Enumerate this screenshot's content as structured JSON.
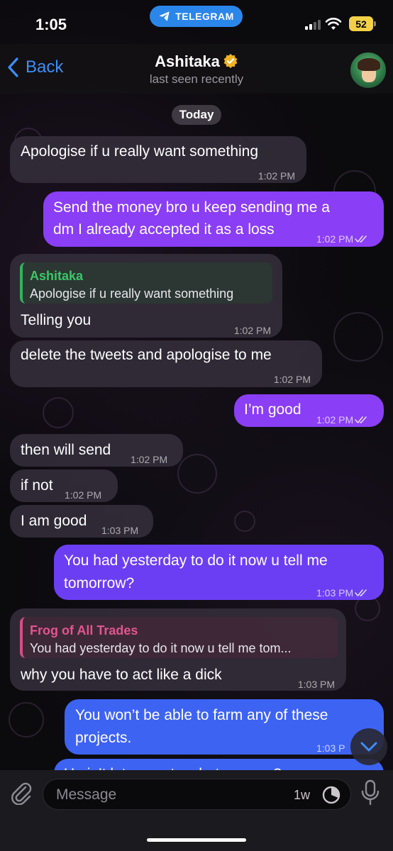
{
  "status_bar": {
    "time": "1:05",
    "app_pill": "TELEGRAM",
    "battery": "52"
  },
  "header": {
    "back_label": "Back",
    "contact_name": "Ashitaka",
    "last_seen": "last seen recently"
  },
  "chat": {
    "date_chip": "Today",
    "messages": [
      {
        "direction": "in",
        "lines": [
          "Apologise if u really want something"
        ],
        "time": "1:02 PM"
      },
      {
        "direction": "out",
        "lines": [
          "Send the money bro u keep sending me a",
          "dm I already accepted it as a loss"
        ],
        "time": "1:02 PM",
        "read": true
      },
      {
        "direction": "in",
        "reply_to": {
          "name": "Ashitaka",
          "text": "Apologise if u really want something"
        },
        "lines": [
          "Telling you"
        ],
        "time": "1:02 PM"
      },
      {
        "direction": "in",
        "lines": [
          "delete the tweets and apologise to me"
        ],
        "time": "1:02 PM"
      },
      {
        "direction": "out",
        "lines": [
          "I’m good"
        ],
        "time": "1:02 PM",
        "read": true
      },
      {
        "direction": "in",
        "lines": [
          "then will send"
        ],
        "time": "1:02 PM"
      },
      {
        "direction": "in",
        "lines": [
          "if not"
        ],
        "time": "1:02 PM"
      },
      {
        "direction": "in",
        "lines": [
          "I am good"
        ],
        "time": "1:03 PM"
      },
      {
        "direction": "out",
        "lines": [
          "You had yesterday to do it now u tell me",
          "tomorrow?"
        ],
        "time": "1:03 PM",
        "read": true
      },
      {
        "direction": "in",
        "reply_to": {
          "name": "Frog of All Trades",
          "text": "You had yesterday to do it now u tell me tom..."
        },
        "lines": [
          "why you have to act like a dick"
        ],
        "time": "1:03 PM"
      },
      {
        "direction": "out",
        "lines": [
          "You won’t be able to farm any of these",
          "projects."
        ],
        "time": "1:03 P"
      },
      {
        "direction": "out",
        "lines": [
          "U ain’t let me act - what u mean?"
        ],
        "partial": true
      }
    ]
  },
  "input": {
    "placeholder": "Message",
    "timer_label": "1w"
  },
  "colors": {
    "accent_blue": "#3d8ef7",
    "bubble_purple": "#8a3ef5",
    "bubble_violet": "#6b3ef4",
    "bubble_blue": "#3d63f3",
    "incoming_bubble": "#322c38",
    "reply_green": "#2fb45a",
    "reply_pink": "#d94b84"
  },
  "icons": [
    "telegram-plane-icon",
    "signal-icon",
    "wifi-icon",
    "battery-icon",
    "chevron-left-icon",
    "verified-badge-icon",
    "double-check-icon",
    "chevron-down-icon",
    "paperclip-icon",
    "timer-icon",
    "microphone-icon"
  ]
}
